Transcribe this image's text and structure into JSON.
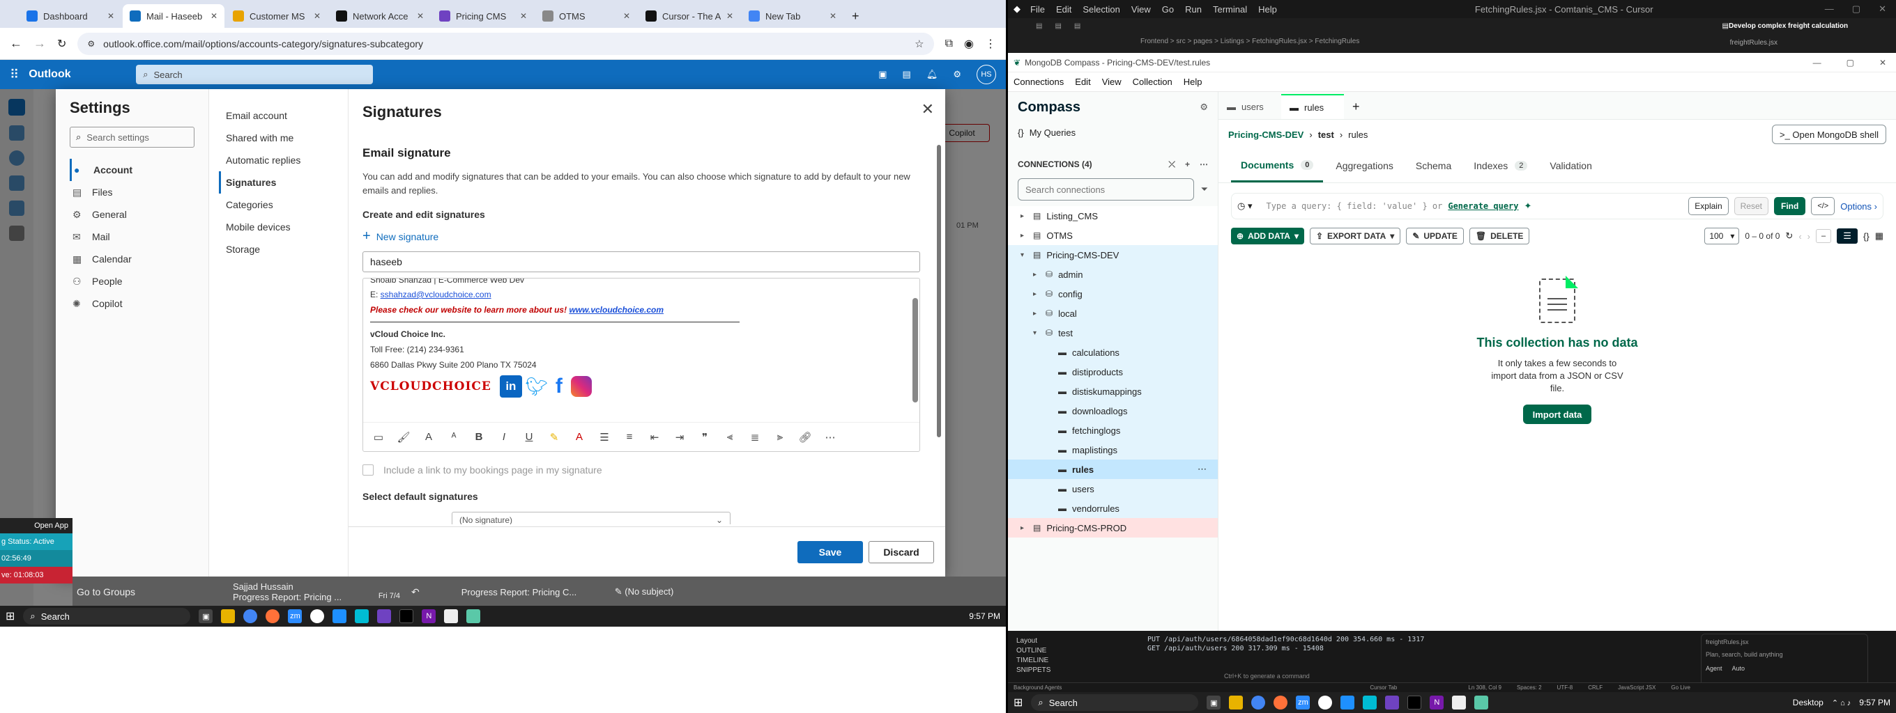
{
  "browser": {
    "tabs": [
      {
        "label": "Dashboard",
        "color": "#1a73e8"
      },
      {
        "label": "Mail - Haseeb",
        "color": "#0f6cbd"
      },
      {
        "label": "Customer MS",
        "color": "#e8a300"
      },
      {
        "label": "Network Acce",
        "color": "#111111"
      },
      {
        "label": "Pricing CMS",
        "color": "#6f42c1"
      },
      {
        "label": "OTMS",
        "color": "#888888"
      },
      {
        "label": "Cursor - The A",
        "color": "#111111"
      },
      {
        "label": "New Tab",
        "color": "#4285f4"
      }
    ],
    "url": "outlook.office.com/mail/options/accounts-category/signatures-subcategory"
  },
  "outlook": {
    "app": "Outlook",
    "search_placeholder": "Search",
    "avatar": "HS",
    "copilot_button": "Copilot",
    "time_stub": "01 PM",
    "bottom": {
      "go_to_groups": "Go to Groups",
      "sender": "Sajjad Hussain",
      "subject": "Progress Report: Pricing ...",
      "date": "Fri 7/4",
      "tab1": "Progress Report: Pricing C...",
      "tab2": "(No subject)"
    },
    "widget": {
      "open_app": "Open App",
      "status": "g Status: Active",
      "t1": "02:56:49",
      "t2": "ve: 01:08:03"
    }
  },
  "settings": {
    "title": "Settings",
    "search_placeholder": "Search settings",
    "nav": [
      {
        "label": "Account",
        "icon": "person-icon",
        "sel": true
      },
      {
        "label": "Files",
        "icon": "file-icon",
        "sel": false
      },
      {
        "label": "General",
        "icon": "gear-icon",
        "sel": false
      },
      {
        "label": "Mail",
        "icon": "mail-icon",
        "sel": false
      },
      {
        "label": "Calendar",
        "icon": "calendar-icon",
        "sel": false
      },
      {
        "label": "People",
        "icon": "people-icon",
        "sel": false
      },
      {
        "label": "Copilot",
        "icon": "copilot-icon",
        "sel": false
      }
    ],
    "sub": [
      {
        "label": "Email account",
        "sel": false
      },
      {
        "label": "Shared with me",
        "sel": false
      },
      {
        "label": "Automatic replies",
        "sel": false
      },
      {
        "label": "Signatures",
        "sel": true
      },
      {
        "label": "Categories",
        "sel": false
      },
      {
        "label": "Mobile devices",
        "sel": false
      },
      {
        "label": "Storage",
        "sel": false
      }
    ],
    "panel_title": "Signatures",
    "section": "Email signature",
    "desc": "You can add and modify signatures that can be added to your emails. You can also choose which signature to add by default to your new emails and replies.",
    "create_label": "Create and edit signatures",
    "new_signature": "New signature",
    "sig_name": "haseeb",
    "sig": {
      "line0": "Shoaib Shahzad | E-Commerce Web Dev",
      "email_prefix": "E: ",
      "email": "sshahzad@vcloudchoice.com",
      "promo": "Please check our website to learn more about us!",
      "site": "www.vcloudchoice.com",
      "company": "vCloud Choice Inc.",
      "toll": "Toll Free: (214) 234-9361",
      "address": "6860 Dallas Pkwy Suite 200 Plano TX 75024",
      "logo": "VCLOUDCHOICE"
    },
    "bookings": "Include a link to my bookings page in my signature",
    "default_label": "Select default signatures",
    "default_value": "(No signature)",
    "save": "Save",
    "discard": "Discard"
  },
  "taskbar_left": {
    "search": "Search",
    "time": "9:57 PM"
  },
  "cursor": {
    "menu": [
      "File",
      "Edit",
      "Selection",
      "View",
      "Go",
      "Run",
      "Terminal",
      "Help"
    ],
    "title": "FetchingRules.jsx - Comtanis_CMS - Cursor",
    "breadcrumb": "Frontend > src > pages > Listings > FetchingRules.jsx > FetchingRules",
    "panel_title": "Develop complex freight calculation",
    "panel_file": "freightRules.jsx",
    "terminal": [
      "PUT /api/auth/users/6864058dad1ef90c68d1640d 200 354.660 ms - 1317",
      "GET /api/auth/users 200 317.309 ms - 15408"
    ],
    "outline": [
      "Layout",
      "OUTLINE",
      "TIMELINE",
      "SNIPPETS"
    ],
    "status": "Cursor Tab",
    "chat_hint": "Plan, search, build anything",
    "agent_label": "Agent",
    "auto_label": "Auto",
    "cmd_hint": "Ctrl+K to generate a command",
    "background": "Background Agents",
    "pos": "Ln 308, Col 9",
    "spaces": "Spaces: 2",
    "encoding": "UTF-8",
    "eol": "CRLF",
    "lang": "JavaScript JSX",
    "golive": "Go Live"
  },
  "compass": {
    "window_title": "MongoDB Compass - Pricing-CMS-DEV/test.rules",
    "menu": [
      "Connections",
      "Edit",
      "View",
      "Collection",
      "Help"
    ],
    "app": "Compass",
    "my_queries": "My Queries",
    "connections_label": "CONNECTIONS (4)",
    "search_placeholder": "Search connections",
    "tree": [
      {
        "label": "Listing_CMS",
        "level": 0,
        "kind": "conn",
        "arrow": "▸"
      },
      {
        "label": "OTMS",
        "level": 0,
        "kind": "conn",
        "arrow": "▸"
      },
      {
        "label": "Pricing-CMS-DEV",
        "level": 0,
        "kind": "conn",
        "arrow": "▾"
      },
      {
        "label": "admin",
        "level": 1,
        "kind": "db",
        "arrow": "▸"
      },
      {
        "label": "config",
        "level": 1,
        "kind": "db",
        "arrow": "▸"
      },
      {
        "label": "local",
        "level": 1,
        "kind": "db",
        "arrow": "▸"
      },
      {
        "label": "test",
        "level": 1,
        "kind": "db",
        "arrow": "▾"
      },
      {
        "label": "calculations",
        "level": 2,
        "kind": "coll",
        "arrow": ""
      },
      {
        "label": "distiproducts",
        "level": 2,
        "kind": "coll",
        "arrow": ""
      },
      {
        "label": "distiskumappings",
        "level": 2,
        "kind": "coll",
        "arrow": ""
      },
      {
        "label": "downloadlogs",
        "level": 2,
        "kind": "coll",
        "arrow": ""
      },
      {
        "label": "fetchinglogs",
        "level": 2,
        "kind": "coll",
        "arrow": ""
      },
      {
        "label": "maplistings",
        "level": 2,
        "kind": "coll",
        "arrow": ""
      },
      {
        "label": "rules",
        "level": 2,
        "kind": "coll",
        "arrow": "",
        "sel": true
      },
      {
        "label": "users",
        "level": 2,
        "kind": "coll",
        "arrow": ""
      },
      {
        "label": "vendorrules",
        "level": 2,
        "kind": "coll",
        "arrow": ""
      },
      {
        "label": "Pricing-CMS-PROD",
        "level": 0,
        "kind": "conn",
        "arrow": "▸",
        "prod": true
      }
    ],
    "tabs": [
      "users",
      "rules"
    ],
    "breadcrumb": [
      "Pricing-CMS-DEV",
      "test",
      "rules"
    ],
    "shell": "Open MongoDB shell",
    "subtabs": [
      {
        "label": "Documents",
        "badge": "0"
      },
      {
        "label": "Aggregations",
        "badge": ""
      },
      {
        "label": "Schema",
        "badge": ""
      },
      {
        "label": "Indexes",
        "badge": "2"
      },
      {
        "label": "Validation",
        "badge": ""
      }
    ],
    "query_placeholder": "Type a query: { field: 'value' } or",
    "generate": "Generate query",
    "explain": "Explain",
    "reset": "Reset",
    "find": "Find",
    "options": "Options",
    "add_data": "ADD DATA",
    "export_data": "EXPORT DATA",
    "update": "UPDATE",
    "delete": "DELETE",
    "page_size": "100",
    "range": "0 – 0 of 0",
    "empty_title": "This collection has no data",
    "empty_desc": "It only takes a few seconds to import data from a JSON or CSV file.",
    "import": "Import data"
  },
  "taskbar_right": {
    "search": "Search",
    "desktop": "Desktop",
    "time": "9:57 PM"
  },
  "colors": {
    "outlook_blue": "#0f6cbd",
    "mongo_green": "#00684a",
    "mongo_dark": "#001e2b",
    "promo_red": "#c00000"
  }
}
